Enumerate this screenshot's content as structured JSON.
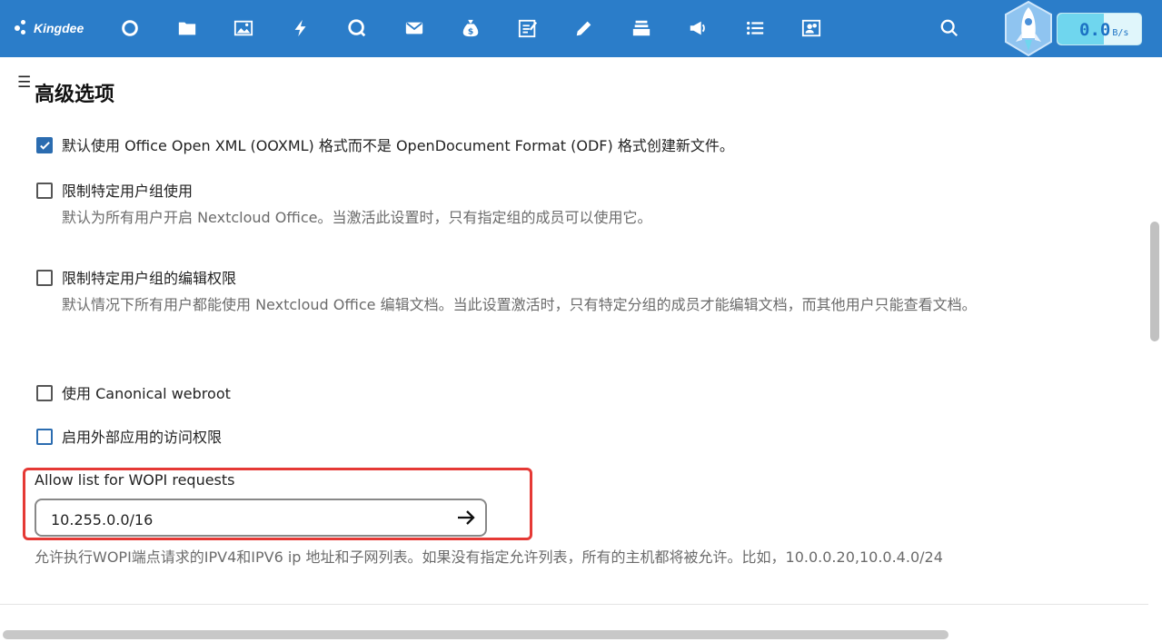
{
  "app": {
    "brand": "Kingdee"
  },
  "toolbar": {
    "icons": [
      "circle-icon",
      "folder-icon",
      "image-icon",
      "bolt-icon",
      "chat-icon",
      "mail-icon",
      "money-bag-icon",
      "notes-icon",
      "pencil-icon",
      "stack-icon",
      "megaphone-icon",
      "list-icon",
      "contacts-icon",
      "search-icon"
    ]
  },
  "speed": {
    "value": "0.0",
    "unit": "B/s",
    "level": 0.55
  },
  "page": {
    "title": "高级选项"
  },
  "options": [
    {
      "id": "ooxml",
      "checked": true,
      "label": "默认使用 Office Open XML (OOXML) 格式而不是 OpenDocument Format (ODF) 格式创建新文件。",
      "description": ""
    },
    {
      "id": "limit-groups",
      "checked": false,
      "label": "限制特定用户组使用",
      "description": "默认为所有用户开启 Nextcloud Office。当激活此设置时，只有指定组的成员可以使用它。"
    },
    {
      "id": "limit-edit",
      "checked": false,
      "label": "限制特定用户组的编辑权限",
      "description": "默认情况下所有用户都能使用 Nextcloud Office 编辑文档。当此设置激活时，只有特定分组的成员才能编辑文档，而其他用户只能查看文档。"
    },
    {
      "id": "canonical",
      "checked": false,
      "label": "使用 Canonical webroot",
      "description": ""
    },
    {
      "id": "external-apps",
      "checked": false,
      "label": "启用外部应用的访问权限",
      "description": ""
    }
  ],
  "wopi": {
    "label": "Allow list for WOPI requests",
    "value": "10.255.0.0/16",
    "help": "允许执行WOPI端点请求的IPV4和IPV6 ip 地址和子网列表。如果没有指定允许列表，所有的主机都将被允许。比如，10.0.0.20,10.0.4.0/24"
  },
  "colors": {
    "topbar": "#2b7dc9",
    "highlight": "#e53935",
    "checkbox_checked": "#2b6cb0"
  }
}
